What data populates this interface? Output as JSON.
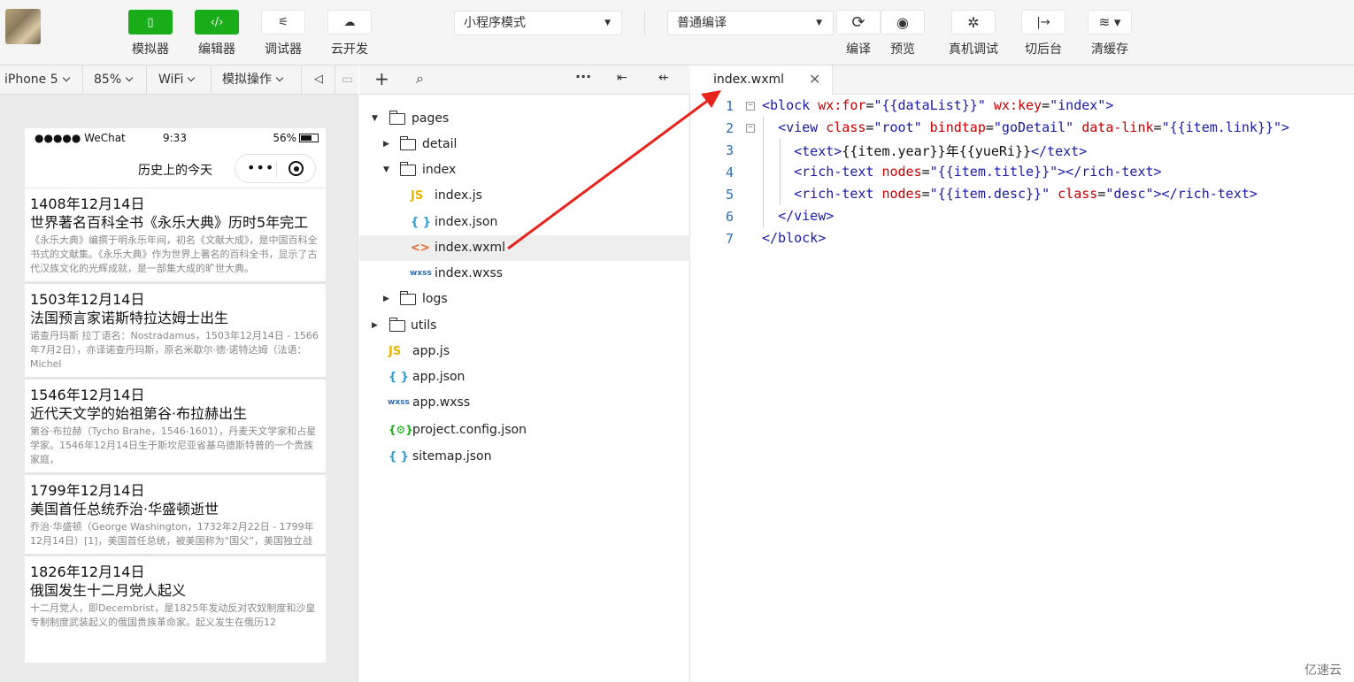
{
  "toolbar": {
    "left_buttons": [
      {
        "icon": "phone-icon",
        "label": "模拟器",
        "active": true
      },
      {
        "icon": "code-icon",
        "label": "编辑器",
        "active": true
      },
      {
        "icon": "sliders-icon",
        "label": "调试器",
        "active": false
      },
      {
        "icon": "cloud-icon",
        "label": "云开发",
        "active": false
      }
    ],
    "mode_select": "小程序模式",
    "compile_select": "普通编译",
    "right_buttons": [
      {
        "icon": "refresh-icon",
        "label": "编译"
      },
      {
        "icon": "eye-icon",
        "label": "预览"
      },
      {
        "icon": "bug-icon",
        "label": "真机调试"
      },
      {
        "icon": "switch-background-icon",
        "label": "切后台"
      },
      {
        "icon": "layers-icon",
        "label": "清缓存"
      }
    ],
    "accent_color": "#1aad19"
  },
  "device_bar": {
    "device": "iPhone 5",
    "zoom": "85%",
    "network": "WiFi",
    "ops": "模拟操作"
  },
  "phone": {
    "status": {
      "carrier": "●●●●● WeChat",
      "time": "9:33",
      "battery": "56%"
    },
    "nav_title": "历史上的今天",
    "items": [
      {
        "year": "1408年12月14日",
        "title": "世界著名百科全书《永乐大典》历时5年完工",
        "desc": "《永乐大典》编撰于明永乐年间，初名《文献大成》，是中国百科全书式的文献集。《永乐大典》作为世界上著名的百科全书，显示了古代汉族文化的光辉成就，是一部集大成的旷世大典。"
      },
      {
        "year": "1503年12月14日",
        "title": "法国预言家诺斯特拉达姆士出生",
        "desc": "诺查丹玛斯 拉丁语名：Nostradamus，1503年12月14日 - 1566年7月2日），亦译诺查丹玛斯，原名米歇尔·德·诺特达姆（法语：Michel"
      },
      {
        "year": "1546年12月14日",
        "title": "近代天文学的始祖第谷·布拉赫出生",
        "desc": "第谷·布拉赫（Tycho Brahe，1546-1601），丹麦天文学家和占星学家。1546年12月14日生于斯坎尼亚省基乌德斯特普的一个贵族家庭，"
      },
      {
        "year": "1799年12月14日",
        "title": "美国首任总统乔治·华盛顿逝世",
        "desc": "乔治·华盛顿（George Washington，1732年2月22日 - 1799年12月14日）[1]，美国首任总统，被美国称为“国父”，美国独立战"
      },
      {
        "year": "1826年12月14日",
        "title": "俄国发生十二月党人起义",
        "desc": "十二月党人，即Decembrist，是1825年发动反对农奴制度和沙皇专制制度武装起义的俄国贵族革命家。起义发生在俄历12"
      }
    ]
  },
  "tree": {
    "nodes": [
      {
        "label": "pages",
        "type": "folder",
        "depth": 0,
        "expanded": true
      },
      {
        "label": "detail",
        "type": "folder",
        "depth": 1,
        "expanded": false
      },
      {
        "label": "index",
        "type": "folder",
        "depth": 1,
        "expanded": true
      },
      {
        "label": "index.js",
        "type": "js",
        "depth": 2
      },
      {
        "label": "index.json",
        "type": "json",
        "depth": 2
      },
      {
        "label": "index.wxml",
        "type": "wxml",
        "depth": 2,
        "selected": true
      },
      {
        "label": "index.wxss",
        "type": "wxss",
        "depth": 2
      },
      {
        "label": "logs",
        "type": "folder",
        "depth": 1,
        "expanded": false
      },
      {
        "label": "utils",
        "type": "folder",
        "depth": 0,
        "expanded": false
      },
      {
        "label": "app.js",
        "type": "js",
        "depth": 0
      },
      {
        "label": "app.json",
        "type": "json",
        "depth": 0
      },
      {
        "label": "app.wxss",
        "type": "wxss",
        "depth": 0
      },
      {
        "label": "project.config.json",
        "type": "config",
        "depth": 0
      },
      {
        "label": "sitemap.json",
        "type": "json",
        "depth": 0
      }
    ]
  },
  "editor": {
    "tab": "index.wxml",
    "lines": [
      "<block wx:for=\"{{dataList}}\" wx:key=\"index\">",
      "  <view class=\"root\" bindtap=\"goDetail\" data-link=\"{{item.link}}\">",
      "    <text>{{item.year}}年{{yueRi}}</text>",
      "    <rich-text nodes=\"{{item.title}}\"></rich-text>",
      "    <rich-text nodes=\"{{item.desc}}\" class=\"desc\"></rich-text>",
      "  </view>",
      "</block>"
    ]
  },
  "watermark": "亿速云"
}
